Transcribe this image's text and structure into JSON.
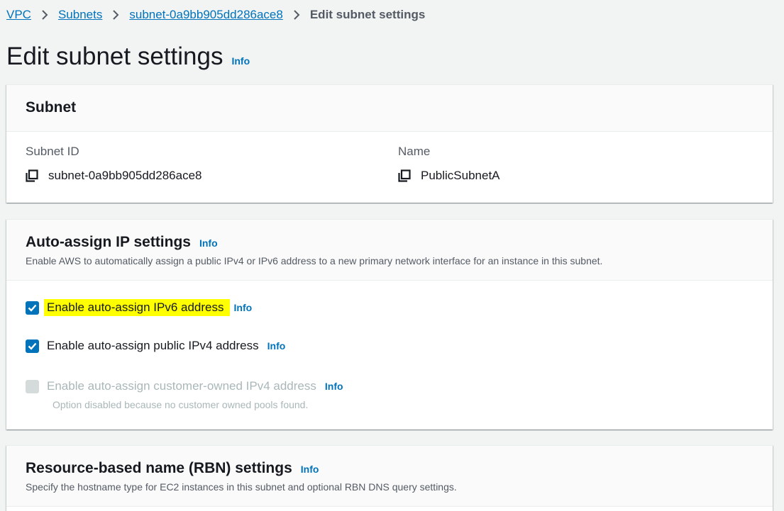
{
  "breadcrumb": {
    "items": [
      "VPC",
      "Subnets",
      "subnet-0a9bb905dd286ace8"
    ],
    "current": "Edit subnet settings"
  },
  "page": {
    "title": "Edit subnet settings",
    "info": "Info"
  },
  "subnet_panel": {
    "heading": "Subnet",
    "subnet_id_label": "Subnet ID",
    "subnet_id_value": "subnet-0a9bb905dd286ace8",
    "name_label": "Name",
    "name_value": "PublicSubnetA"
  },
  "ip_panel": {
    "heading": "Auto-assign IP settings",
    "info": "Info",
    "description": "Enable AWS to automatically assign a public IPv4 or IPv6 address to a new primary network interface for an instance in this subnet.",
    "options": [
      {
        "label": "Enable auto-assign IPv6 address",
        "info": "Info",
        "checked": true,
        "highlighted": true
      },
      {
        "label": "Enable auto-assign public IPv4 address",
        "info": "Info",
        "checked": true
      },
      {
        "label": "Enable auto-assign customer-owned IPv4 address",
        "info": "Info",
        "checked": false,
        "disabled": true,
        "hint": "Option disabled because no customer owned pools found."
      }
    ]
  },
  "rbn_panel": {
    "heading": "Resource-based name (RBN) settings",
    "info": "Info",
    "description": "Specify the hostname type for EC2 instances in this subnet and optional RBN DNS query settings."
  },
  "colors": {
    "link": "#0073bb",
    "checkbox_checked": "#0073bb",
    "highlight": "#ffff00",
    "background": "#f2f3f3"
  }
}
